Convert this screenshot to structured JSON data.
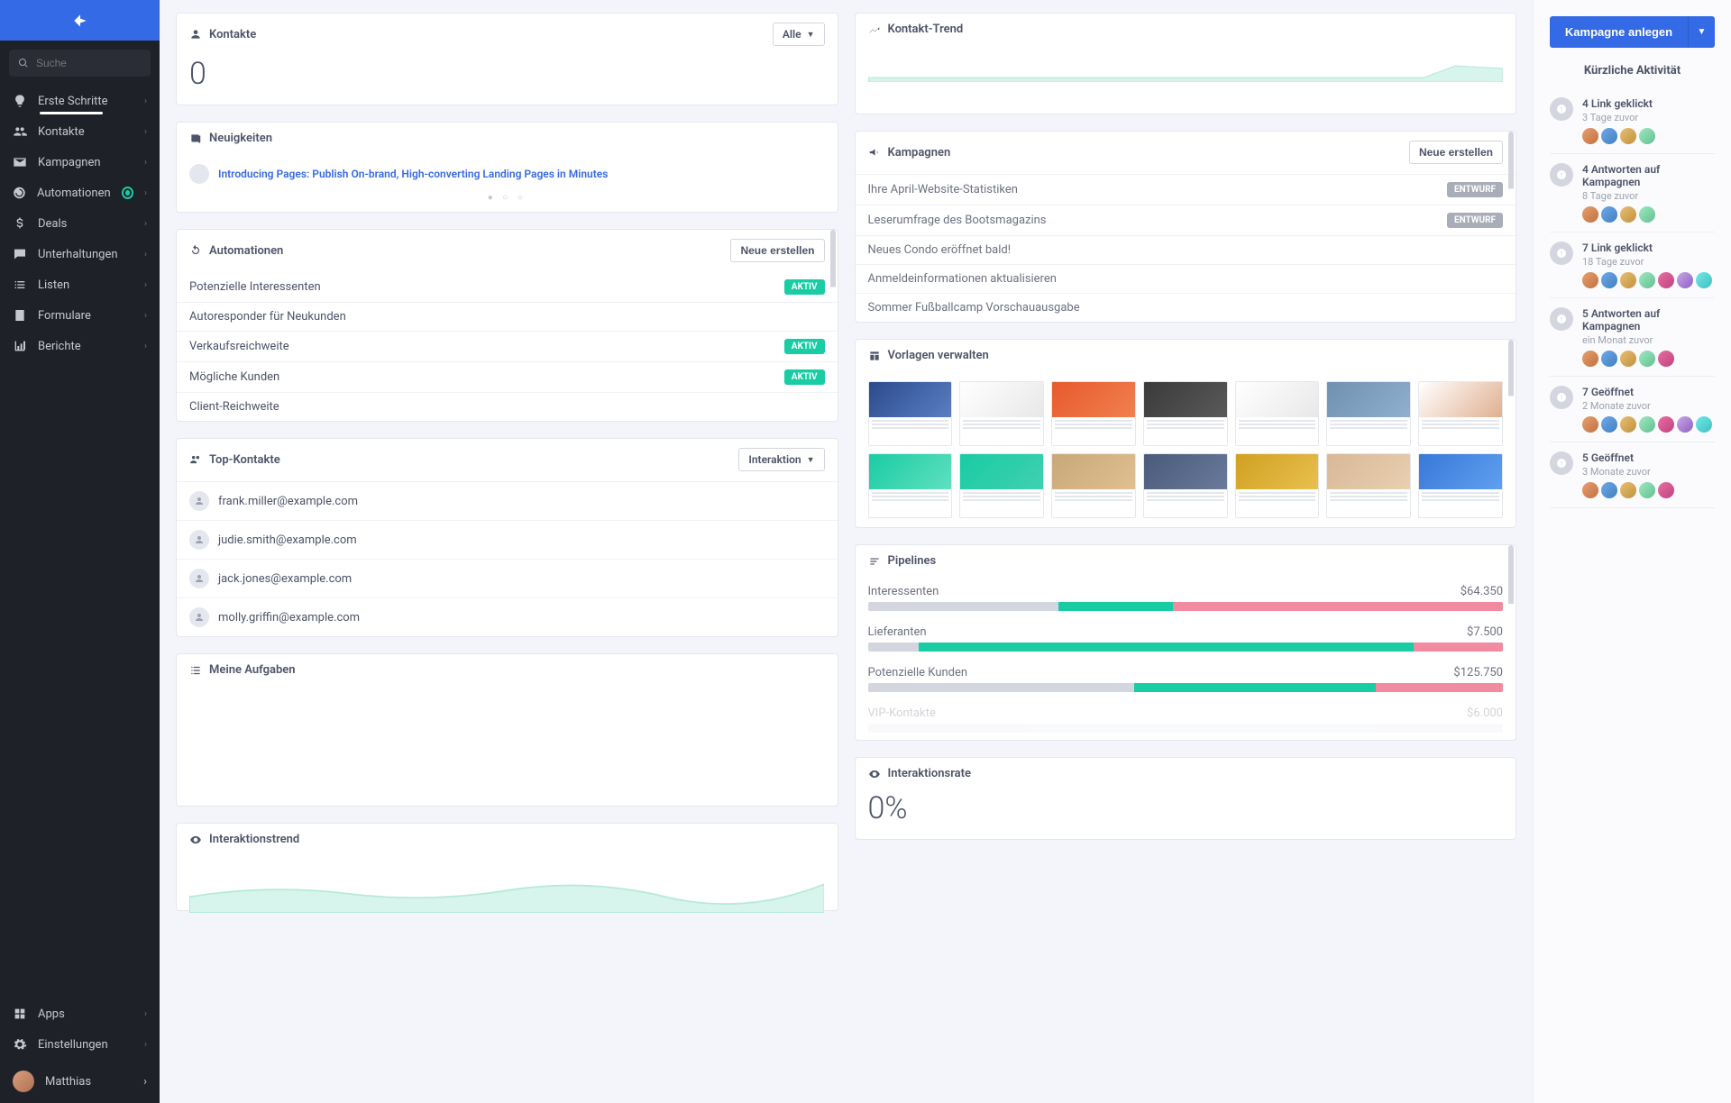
{
  "search": {
    "placeholder": "Suche"
  },
  "nav": {
    "items": [
      {
        "label": "Erste Schritte"
      },
      {
        "label": "Kontakte"
      },
      {
        "label": "Kampagnen"
      },
      {
        "label": "Automationen"
      },
      {
        "label": "Deals"
      },
      {
        "label": "Unterhaltungen"
      },
      {
        "label": "Listen"
      },
      {
        "label": "Formulare"
      },
      {
        "label": "Berichte"
      }
    ],
    "bottom": [
      {
        "label": "Apps"
      },
      {
        "label": "Einstellungen"
      }
    ],
    "user": "Matthias"
  },
  "kontakte": {
    "title": "Kontakte",
    "filter": "Alle",
    "count": "0"
  },
  "neuigkeiten": {
    "title": "Neuigkeiten",
    "headline": "Introducing Pages: Publish On-brand, High-converting Landing Pages in Minutes"
  },
  "automationen": {
    "title": "Automationen",
    "create": "Neue erstellen",
    "items": [
      {
        "name": "Potenzielle Interessenten",
        "status": "AKTIV"
      },
      {
        "name": "Autoresponder für Neukunden",
        "status": ""
      },
      {
        "name": "Verkaufsreichweite",
        "status": "AKTIV"
      },
      {
        "name": "Mögliche Kunden",
        "status": "AKTIV"
      },
      {
        "name": "Client-Reichweite",
        "status": ""
      }
    ]
  },
  "topkontakte": {
    "title": "Top-Kontakte",
    "filter": "Interaktion",
    "items": [
      "frank.miller@example.com",
      "judie.smith@example.com",
      "jack.jones@example.com",
      "molly.griffin@example.com"
    ]
  },
  "aufgaben": {
    "title": "Meine Aufgaben"
  },
  "trend": {
    "title": "Kontakt-Trend"
  },
  "kampagnen": {
    "title": "Kampagnen",
    "create": "Neue erstellen",
    "items": [
      {
        "name": "Ihre April-Website-Statistiken",
        "status": "ENTWURF"
      },
      {
        "name": "Leserumfrage des Bootsmagazins",
        "status": "ENTWURF"
      },
      {
        "name": "Neues Condo eröffnet bald!",
        "status": ""
      },
      {
        "name": "Anmeldeinformationen aktualisieren",
        "status": ""
      },
      {
        "name": "Sommer Fußballcamp Vorschauausgabe",
        "status": ""
      }
    ]
  },
  "vorlagen": {
    "title": "Vorlagen verwalten"
  },
  "pipelines": {
    "title": "Pipelines",
    "items": [
      {
        "name": "Interessenten",
        "value": "$64.350",
        "seg": [
          30,
          18,
          52
        ]
      },
      {
        "name": "Lieferanten",
        "value": "$7.500",
        "seg": [
          8,
          78,
          14
        ]
      },
      {
        "name": "Potenzielle Kunden",
        "value": "$125.750",
        "seg": [
          42,
          38,
          20
        ]
      },
      {
        "name": "VIP-Kontakte",
        "value": "$6.000",
        "seg": [
          0,
          0,
          0
        ]
      }
    ]
  },
  "rate": {
    "title": "Interaktionsrate",
    "value": "0%"
  },
  "interaktionstrend": {
    "title": "Interaktionstrend"
  },
  "rightpanel": {
    "cta": "Kampagne anlegen",
    "title": "Kürzliche Aktivität",
    "activities": [
      {
        "title": "4 Link geklickt",
        "time": "3 Tage zuvor",
        "n": 4
      },
      {
        "title": "4 Antworten auf Kampagnen",
        "time": "8 Tage zuvor",
        "n": 4
      },
      {
        "title": "7 Link geklickt",
        "time": "18 Tage zuvor",
        "n": 7
      },
      {
        "title": "5 Antworten auf Kampagnen",
        "time": "ein Monat zuvor",
        "n": 5
      },
      {
        "title": "7 Geöffnet",
        "time": "2 Monate zuvor",
        "n": 7
      },
      {
        "title": "5 Geöffnet",
        "time": "3 Monate zuvor",
        "n": 5
      }
    ]
  },
  "chart_data": {
    "type": "line",
    "title": "Kontakt-Trend",
    "series": [
      {
        "name": "Kontakte",
        "values": [
          0,
          0,
          0,
          0,
          0,
          0,
          0,
          0,
          1,
          0
        ]
      }
    ]
  }
}
